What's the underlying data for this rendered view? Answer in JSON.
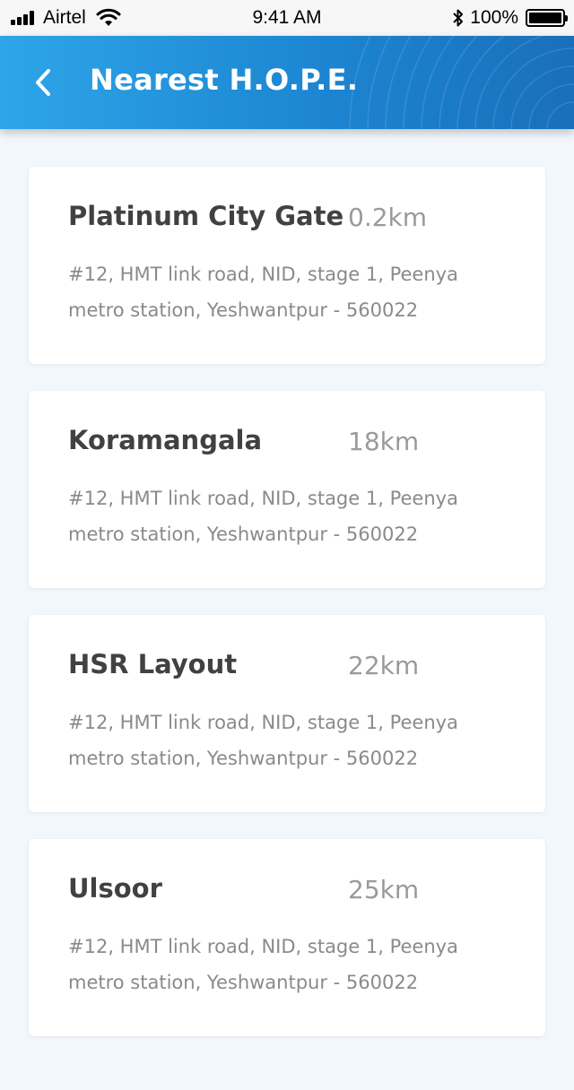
{
  "status_bar": {
    "carrier": "Airtel",
    "time": "9:41 AM",
    "battery": "100%"
  },
  "header": {
    "title": "Nearest H.O.P.E.",
    "back_icon": "chevron-left-icon"
  },
  "locations": [
    {
      "name": "Platinum City Gate",
      "distance": "0.2km",
      "address": "#12, HMT link road, NID, stage 1, Peenya metro station, Yeshwantpur - 560022"
    },
    {
      "name": "Koramangala",
      "distance": "18km",
      "address": "#12, HMT link road, NID, stage 1, Peenya metro station, Yeshwantpur - 560022"
    },
    {
      "name": "HSR Layout",
      "distance": "22km",
      "address": "#12, HMT link road, NID, stage 1, Peenya metro station, Yeshwantpur - 560022"
    },
    {
      "name": "Ulsoor",
      "distance": "25km",
      "address": "#12, HMT link road, NID, stage 1, Peenya metro station, Yeshwantpur - 560022"
    }
  ]
}
